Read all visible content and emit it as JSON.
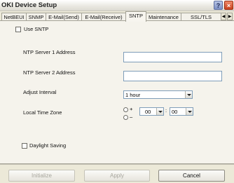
{
  "window": {
    "title": "OKI Device Setup"
  },
  "titlebar_buttons": {
    "help": "?",
    "close": "×"
  },
  "tabs": [
    {
      "label": "NetBEUI"
    },
    {
      "label": "SNMP"
    },
    {
      "label": "E-Mail(Send)"
    },
    {
      "label": "E-Mail(Receive)"
    },
    {
      "label": "SNTP",
      "active": true
    },
    {
      "label": "Maintenance"
    },
    {
      "label": "SSL/TLS"
    }
  ],
  "tab_scroll": {
    "left": "◀",
    "right": "▶"
  },
  "sntp": {
    "use_sntp_label": "Use SNTP",
    "use_sntp_checked": false,
    "server1_label": "NTP Server 1 Address",
    "server1_value": "",
    "server2_label": "NTP Server 2 Address",
    "server2_value": "",
    "adjust_interval_label": "Adjust Interval",
    "adjust_interval_value": "1 hour",
    "timezone_label": "Local Time Zone",
    "tz_plus": "+",
    "tz_minus": "–",
    "tz_hours": "00",
    "tz_colon": ":",
    "tz_minutes": "00",
    "daylight_label": "Daylight Saving",
    "daylight_checked": false
  },
  "buttons": {
    "initialize": "Initialize",
    "apply": "Apply",
    "cancel": "Cancel"
  }
}
